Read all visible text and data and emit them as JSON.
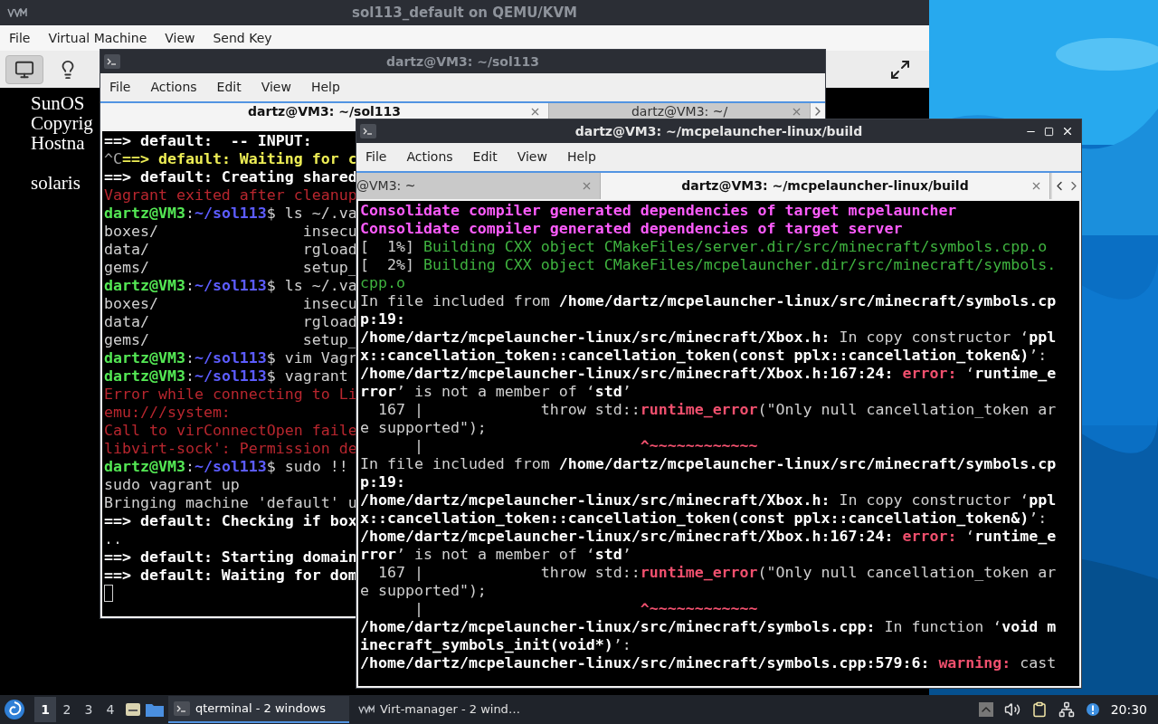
{
  "vm_window": {
    "title": "sol113_default on QEMU/KVM",
    "menu": [
      "File",
      "Virtual Machine",
      "View",
      "Send Key"
    ],
    "toolbar": [
      {
        "kind": "console",
        "selected": true
      },
      {
        "kind": "details",
        "selected": false
      }
    ],
    "console_lines": [
      "SunOS",
      "Copyrig",
      "Hostna",
      "solaris"
    ]
  },
  "back_terminal": {
    "title": "dartz@VM3: ~/sol113",
    "menu": [
      "File",
      "Actions",
      "Edit",
      "View",
      "Help"
    ],
    "tabs": [
      {
        "label": "dartz@VM3: ~/sol113",
        "selected": true
      },
      {
        "label": "dartz@VM3: ~/",
        "selected": false
      }
    ],
    "lines": [
      [
        {
          "text": "==> default:  -- INPUT:",
          "kind": "bold"
        }
      ],
      [
        {
          "text": "^C",
          "kind": "dim"
        },
        {
          "text": "==> default: Waiting for c",
          "kind": "yellow"
        }
      ],
      [
        {
          "text": "==> default: Creating shared",
          "kind": "bold"
        }
      ],
      [
        {
          "text": "Vagrant exited after cleanup",
          "kind": "red"
        }
      ],
      [
        {
          "text": "dartz@VM3",
          "kind": "user"
        },
        {
          "text": ":",
          "kind": "plain"
        },
        {
          "text": "~/sol113",
          "kind": "path"
        },
        {
          "text": "$ ls ~/.va",
          "kind": "plain"
        }
      ],
      [
        {
          "text": "boxes/                insecu",
          "kind": "plain"
        }
      ],
      [
        {
          "text": "data/                 rgload",
          "kind": "plain"
        }
      ],
      [
        {
          "text": "gems/                 setup_",
          "kind": "plain"
        }
      ],
      [
        {
          "text": "dartz@VM3",
          "kind": "user"
        },
        {
          "text": ":",
          "kind": "plain"
        },
        {
          "text": "~/sol113",
          "kind": "path"
        },
        {
          "text": "$ ls ~/.va",
          "kind": "plain"
        }
      ],
      [
        {
          "text": "boxes/                insecu",
          "kind": "plain"
        }
      ],
      [
        {
          "text": "data/                 rgload",
          "kind": "plain"
        }
      ],
      [
        {
          "text": "gems/                 setup_",
          "kind": "plain"
        }
      ],
      [
        {
          "text": "dartz@VM3",
          "kind": "user"
        },
        {
          "text": ":",
          "kind": "plain"
        },
        {
          "text": "~/sol113",
          "kind": "path"
        },
        {
          "text": "$ vim Vagr",
          "kind": "plain"
        }
      ],
      [
        {
          "text": "dartz@VM3",
          "kind": "user"
        },
        {
          "text": ":",
          "kind": "plain"
        },
        {
          "text": "~/sol113",
          "kind": "path"
        },
        {
          "text": "$ vagrant",
          "kind": "plain"
        }
      ],
      [
        {
          "text": "Error while connecting to Li",
          "kind": "red"
        }
      ],
      [
        {
          "text": "emu:///system:",
          "kind": "red"
        }
      ],
      [
        {
          "text": "Call to virConnectOpen faile",
          "kind": "red"
        }
      ],
      [
        {
          "text": "libvirt-sock': Permission de",
          "kind": "red"
        }
      ],
      [
        {
          "text": "dartz@VM3",
          "kind": "user"
        },
        {
          "text": ":",
          "kind": "plain"
        },
        {
          "text": "~/sol113",
          "kind": "path"
        },
        {
          "text": "$ sudo !!",
          "kind": "plain"
        }
      ],
      [
        {
          "text": "sudo vagrant up",
          "kind": "plain"
        }
      ],
      [
        {
          "text": "Bringing machine 'default' u",
          "kind": "plain"
        }
      ],
      [
        {
          "text": "==> default: Checking if box",
          "kind": "bold"
        }
      ],
      [
        {
          "text": "..",
          "kind": "plain"
        }
      ],
      [
        {
          "text": "==> default: Starting domain",
          "kind": "bold"
        }
      ],
      [
        {
          "text": "==> default: Waiting for dom",
          "kind": "bold"
        }
      ]
    ]
  },
  "front_terminal": {
    "title": "dartz@VM3: ~/mcpelauncher-linux/build",
    "menu": [
      "File",
      "Actions",
      "Edit",
      "View",
      "Help"
    ],
    "tabs": [
      {
        "label": "@VM3: ~",
        "selected": false
      },
      {
        "label": "dartz@VM3: ~/mcpelauncher-linux/build",
        "selected": true
      }
    ],
    "lines": [
      [
        {
          "text": "Consolidate compiler generated dependencies of target mcpelauncher",
          "kind": "magenta"
        }
      ],
      [
        {
          "text": "Consolidate compiler generated dependencies of target server",
          "kind": "magenta"
        }
      ],
      [
        {
          "text": "[  1%] ",
          "kind": "plain"
        },
        {
          "text": "Building CXX object CMakeFiles/server.dir/src/minecraft/symbols.cpp.o",
          "kind": "green"
        }
      ],
      [
        {
          "text": "[  2%] ",
          "kind": "plain"
        },
        {
          "text": "Building CXX object CMakeFiles/mcpelauncher.dir/src/minecraft/symbols.",
          "kind": "green"
        }
      ],
      [
        {
          "text": "cpp.o",
          "kind": "green"
        }
      ],
      [
        {
          "text": "In file included from ",
          "kind": "plain"
        },
        {
          "text": "/home/dartz/mcpelauncher-linux/src/minecraft/symbols.cp",
          "kind": "bold"
        }
      ],
      [
        {
          "text": "p:19:",
          "kind": "bold"
        }
      ],
      [
        {
          "text": "/home/dartz/mcpelauncher-linux/src/minecraft/Xbox.h:",
          "kind": "bold"
        },
        {
          "text": " In copy constructor ‘",
          "kind": "plain"
        },
        {
          "text": "ppl",
          "kind": "bold"
        }
      ],
      [
        {
          "text": "x::cancellation_token::cancellation_token(const pplx::cancellation_token&)",
          "kind": "bold"
        },
        {
          "text": "’:",
          "kind": "plain"
        }
      ],
      [
        {
          "text": "/home/dartz/mcpelauncher-linux/src/minecraft/Xbox.h:167:24:",
          "kind": "bold"
        },
        {
          "text": " error:",
          "kind": "error"
        },
        {
          "text": " ‘",
          "kind": "plain"
        },
        {
          "text": "runtime_e",
          "kind": "bold"
        }
      ],
      [
        {
          "text": "rror",
          "kind": "bold"
        },
        {
          "text": "’ is not a member of ‘",
          "kind": "plain"
        },
        {
          "text": "std",
          "kind": "bold"
        },
        {
          "text": "’",
          "kind": "plain"
        }
      ],
      [
        {
          "text": "  167 |             throw std::",
          "kind": "plain"
        },
        {
          "text": "runtime_error",
          "kind": "errtext"
        },
        {
          "text": "(\"Only null cancellation_token ar",
          "kind": "plain"
        }
      ],
      [
        {
          "text": "e supported\");",
          "kind": "plain"
        }
      ],
      [
        {
          "text": "      |                        ",
          "kind": "plain"
        },
        {
          "text": "^~~~~~~~~~~~~",
          "kind": "errtext"
        }
      ],
      [
        {
          "text": "In file included from ",
          "kind": "plain"
        },
        {
          "text": "/home/dartz/mcpelauncher-linux/src/minecraft/symbols.cp",
          "kind": "bold"
        }
      ],
      [
        {
          "text": "p:19:",
          "kind": "bold"
        }
      ],
      [
        {
          "text": "/home/dartz/mcpelauncher-linux/src/minecraft/Xbox.h:",
          "kind": "bold"
        },
        {
          "text": " In copy constructor ‘",
          "kind": "plain"
        },
        {
          "text": "ppl",
          "kind": "bold"
        }
      ],
      [
        {
          "text": "x::cancellation_token::cancellation_token(const pplx::cancellation_token&)",
          "kind": "bold"
        },
        {
          "text": "’:",
          "kind": "plain"
        }
      ],
      [
        {
          "text": "/home/dartz/mcpelauncher-linux/src/minecraft/Xbox.h:167:24:",
          "kind": "bold"
        },
        {
          "text": " error:",
          "kind": "error"
        },
        {
          "text": " ‘",
          "kind": "plain"
        },
        {
          "text": "runtime_e",
          "kind": "bold"
        }
      ],
      [
        {
          "text": "rror",
          "kind": "bold"
        },
        {
          "text": "’ is not a member of ‘",
          "kind": "plain"
        },
        {
          "text": "std",
          "kind": "bold"
        },
        {
          "text": "’",
          "kind": "plain"
        }
      ],
      [
        {
          "text": "  167 |             throw std::",
          "kind": "plain"
        },
        {
          "text": "runtime_error",
          "kind": "errtext"
        },
        {
          "text": "(\"Only null cancellation_token ar",
          "kind": "plain"
        }
      ],
      [
        {
          "text": "e supported\");",
          "kind": "plain"
        }
      ],
      [
        {
          "text": "      |                        ",
          "kind": "plain"
        },
        {
          "text": "^~~~~~~~~~~~~",
          "kind": "errtext"
        }
      ],
      [
        {
          "text": "/home/dartz/mcpelauncher-linux/src/minecraft/symbols.cpp:",
          "kind": "bold"
        },
        {
          "text": " In function ‘",
          "kind": "plain"
        },
        {
          "text": "void m",
          "kind": "bold"
        }
      ],
      [
        {
          "text": "inecraft_symbols_init(void*)",
          "kind": "bold"
        },
        {
          "text": "’:",
          "kind": "plain"
        }
      ],
      [
        {
          "text": "/home/dartz/mcpelauncher-linux/src/minecraft/symbols.cpp:579:6:",
          "kind": "bold"
        },
        {
          "text": " warning:",
          "kind": "error"
        },
        {
          "text": " cast",
          "kind": "plain"
        }
      ]
    ]
  },
  "taskbar": {
    "workspaces": [
      {
        "label": "1",
        "selected": true
      },
      {
        "label": "2",
        "selected": false
      },
      {
        "label": "3",
        "selected": false
      },
      {
        "label": "4",
        "selected": false
      }
    ],
    "tasks": [
      {
        "kind": "terminal",
        "label": "qterminal - 2 windows",
        "selected": true
      },
      {
        "kind": "virt",
        "label": "Virt-manager - 2 wind…",
        "selected": false
      }
    ],
    "clock": "20:30"
  }
}
